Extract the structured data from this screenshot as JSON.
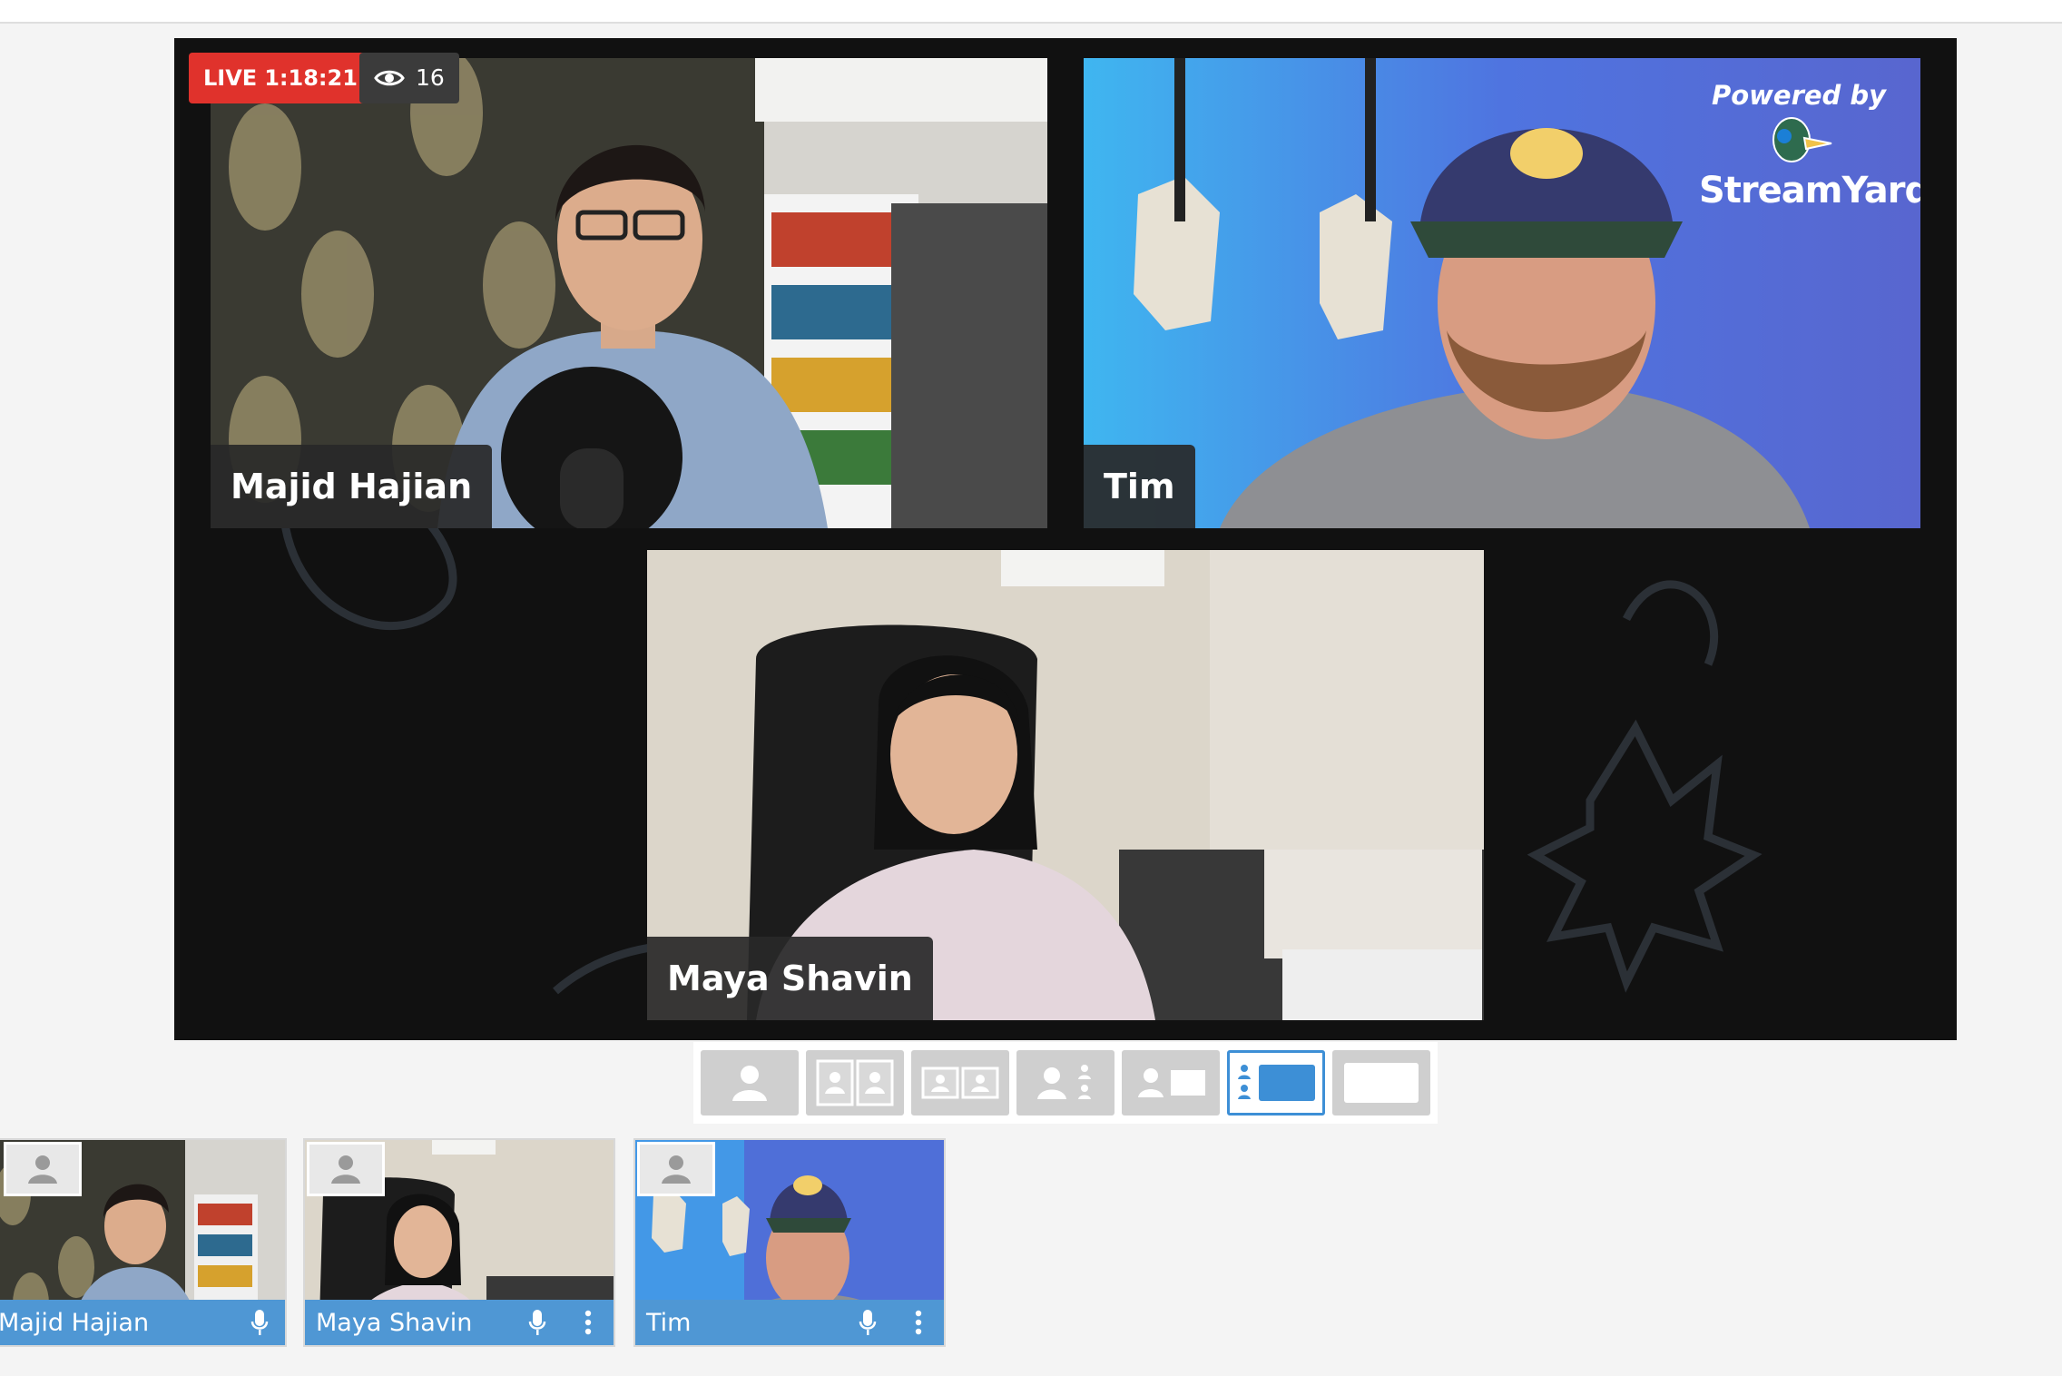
{
  "broadcast": {
    "live_label": "LIVE",
    "live_time": "1:18:21",
    "viewer_count": "16",
    "powered_by": "Powered by",
    "brand": "StreamYard"
  },
  "participants": [
    {
      "name": "Majid Hajian"
    },
    {
      "name": "Tim"
    },
    {
      "name": "Maya Shavin"
    }
  ],
  "thumbnails": [
    {
      "name": "Majid Hajian"
    },
    {
      "name": "Maya Shavin"
    },
    {
      "name": "Tim"
    }
  ],
  "layouts": [
    "solo",
    "cropped",
    "group",
    "leader",
    "screen",
    "picture-in-picture",
    "screen-only"
  ],
  "active_layout": "picture-in-picture",
  "colors": {
    "live": "#e0322c",
    "accent": "#3d8fd6",
    "thumb_bar": "#4f97d4"
  }
}
